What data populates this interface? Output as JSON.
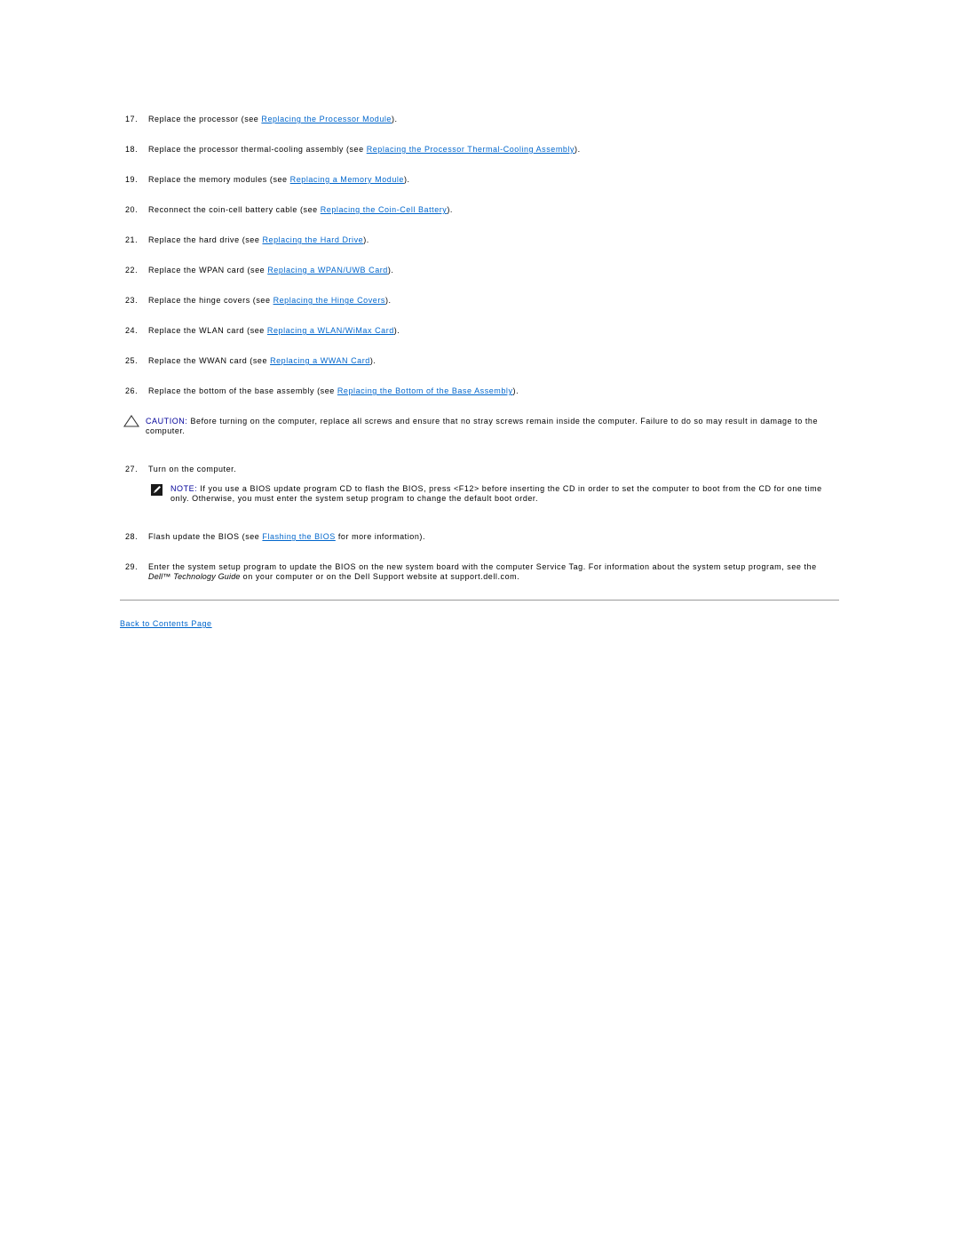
{
  "steps_a": [
    {
      "num": "17.",
      "pre": "Replace the processor (see ",
      "link": "Replacing the Processor Module",
      "post": ")."
    },
    {
      "num": "18.",
      "pre": "Replace the processor thermal-cooling assembly (see ",
      "link": "Replacing the Processor Thermal-Cooling Assembly",
      "post": ")."
    },
    {
      "num": "19.",
      "pre": "Replace the memory modules (see ",
      "link": "Replacing a Memory Module",
      "post": ")."
    },
    {
      "num": "20.",
      "pre": "Reconnect the coin-cell battery cable (see ",
      "link": "Replacing the Coin-Cell Battery",
      "post": ")."
    },
    {
      "num": "21.",
      "pre": "Replace the hard drive (see ",
      "link": "Replacing the Hard Drive",
      "post": ")."
    },
    {
      "num": "22.",
      "pre": "Replace the WPAN card (see ",
      "link": "Replacing a WPAN/UWB Card",
      "post": ")."
    },
    {
      "num": "23.",
      "pre": "Replace the hinge covers (see ",
      "link": "Replacing the Hinge Covers",
      "post": ")."
    },
    {
      "num": "24.",
      "pre": "Replace the WLAN card (see ",
      "link": "Replacing a WLAN/WiMax Card",
      "post": ")."
    },
    {
      "num": "25.",
      "pre": "Replace the WWAN card (see ",
      "link": "Replacing a WWAN Card",
      "post": ")."
    },
    {
      "num": "26.",
      "pre": "Replace the bottom of the base assembly (see ",
      "link": "Replacing the Bottom of the Base Assembly",
      "post": ")."
    }
  ],
  "caution": {
    "icon": "caution-triangle-icon",
    "label": "CAUTION:",
    "text": " Before turning on the computer, replace all screws and ensure that no stray screws remain inside the computer. Failure to do so may result in damage to the computer."
  },
  "step27": {
    "num": "27.",
    "text": "Turn on the computer."
  },
  "note": {
    "icon": "note-pencil-icon",
    "label": "NOTE:",
    "text": " If you use a BIOS update program CD to flash the BIOS, press <F12> before inserting the CD in order to set the computer to boot from the CD for one time only. Otherwise, you must enter the system setup program to change the default boot order."
  },
  "step28": {
    "num": "28.",
    "pre": "Flash update the BIOS (see ",
    "link": "Flashing the BIOS",
    "post": " for more information)."
  },
  "step29": {
    "num": "29.",
    "pre": "Enter the system setup program to update the BIOS on the new system board with the computer Service Tag. For information about the system setup program, see the ",
    "em": "Dell™ Technology Guide",
    "post": " on your computer or on the Dell Support website at support.dell.com."
  },
  "footer": {
    "back_link": "Back to Contents Page"
  },
  "colors": {
    "link": "#0066cc",
    "label": "#000099",
    "divider": "#999999"
  }
}
